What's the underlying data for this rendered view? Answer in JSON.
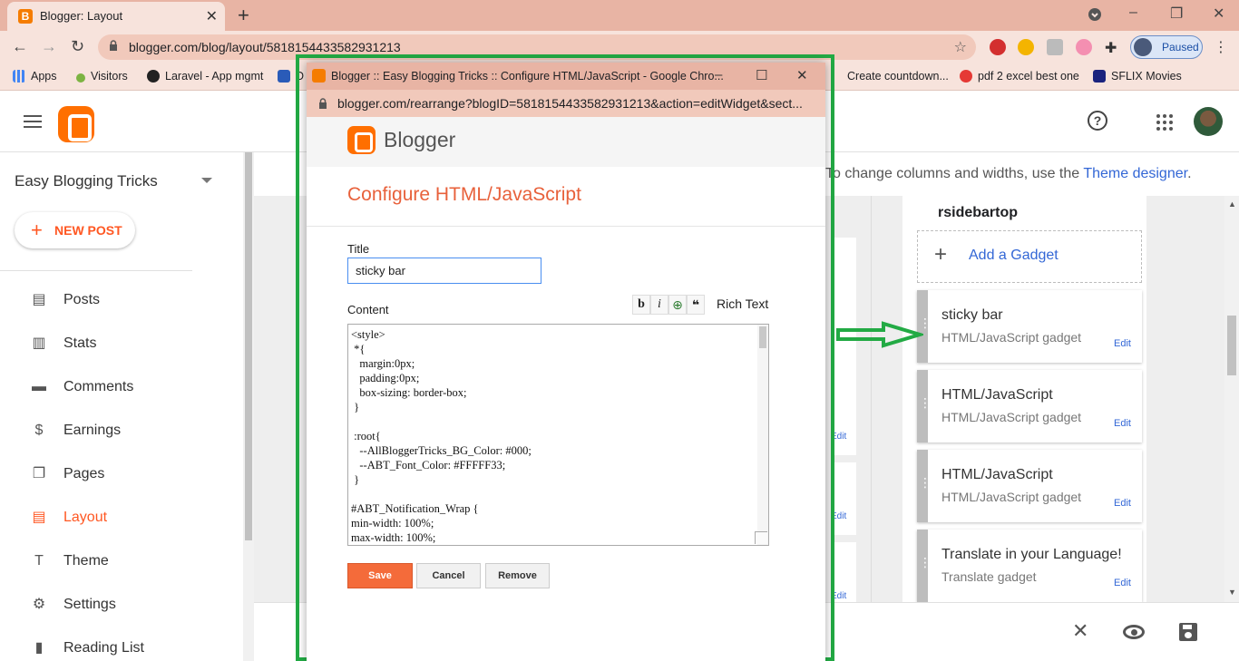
{
  "browser": {
    "tab_title": "Blogger: Layout",
    "tab_close": "✕",
    "new_tab": "+",
    "url": "blogger.com/blog/layout/5818154433582931213",
    "profile_status": "Paused",
    "bookmarks": [
      "Apps",
      "Visitors",
      "Laravel - App mgmt",
      "D",
      "Create countdown...",
      "pdf 2 excel best one",
      "SFLIX Movies"
    ]
  },
  "header": {
    "help_icon": "?"
  },
  "sidebar": {
    "blog_name": "Easy Blogging Tricks",
    "new_post": "NEW POST",
    "items": [
      {
        "label": "Posts",
        "icon": "posts-icon",
        "glyph": "▤"
      },
      {
        "label": "Stats",
        "icon": "stats-icon",
        "glyph": "▥"
      },
      {
        "label": "Comments",
        "icon": "comments-icon",
        "glyph": "▬"
      },
      {
        "label": "Earnings",
        "icon": "earnings-icon",
        "glyph": "$"
      },
      {
        "label": "Pages",
        "icon": "pages-icon",
        "glyph": "❐"
      },
      {
        "label": "Layout",
        "icon": "layout-icon",
        "glyph": "▤",
        "active": true
      },
      {
        "label": "Theme",
        "icon": "theme-icon",
        "glyph": "T"
      },
      {
        "label": "Settings",
        "icon": "settings-icon",
        "glyph": "⚙"
      },
      {
        "label": "Reading List",
        "icon": "reading-list-icon",
        "glyph": "▮"
      }
    ]
  },
  "main": {
    "hint_prefix": "To change columns and widths, use the ",
    "hint_link": "Theme designer",
    "hint_suffix": ".",
    "region_title": "rsidebartop",
    "add_gadget": "Add a Gadget",
    "gadgets": [
      {
        "title": "sticky bar",
        "type": "HTML/JavaScript gadget",
        "edit": "Edit"
      },
      {
        "title": "HTML/JavaScript",
        "type": "HTML/JavaScript gadget",
        "edit": "Edit"
      },
      {
        "title": "HTML/JavaScript",
        "type": "HTML/JavaScript gadget",
        "edit": "Edit"
      },
      {
        "title": "Translate in your Language!",
        "type": "Translate gadget",
        "edit": "Edit"
      }
    ],
    "bg_edit": "Edit"
  },
  "popup": {
    "window_title": "Blogger :: Easy Blogging Tricks :: Configure HTML/JavaScript - Google Chro...",
    "url": "blogger.com/rearrange?blogID=5818154433582931213&action=editWidget&sect...",
    "brand": "Blogger",
    "heading": "Configure HTML/JavaScript",
    "title_label": "Title",
    "title_value": "sticky bar",
    "content_label": "Content",
    "bold_btn": "b",
    "italic_btn": "i",
    "rich_text": "Rich Text",
    "content": "<style>\n *{\n   margin:0px;\n   padding:0px;\n   box-sizing: border-box;\n }\n\n :root{\n   --AllBloggerTricks_BG_Color: #000;\n   --ABT_Font_Color: #FFFFF33;\n }\n\n#ABT_Notification_Wrap {\nmin-width: 100%;\nmax-width: 100%;",
    "save": "Save",
    "cancel": "Cancel",
    "remove": "Remove"
  }
}
